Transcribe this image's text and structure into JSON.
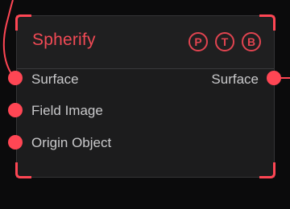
{
  "node": {
    "title": "Spherify",
    "flags": [
      {
        "key": "preview",
        "label": "P"
      },
      {
        "key": "template",
        "label": "T"
      },
      {
        "key": "bypass",
        "label": "B"
      }
    ],
    "inputs": [
      {
        "label": "Surface"
      },
      {
        "label": "Field Image"
      },
      {
        "label": "Origin Object"
      }
    ],
    "outputs": [
      {
        "label": "Surface"
      }
    ]
  },
  "colors": {
    "accent": "#ff4654",
    "title": "#f24a55",
    "node_body": "#1c1c1d",
    "background": "#0b0b0c",
    "label_text": "#c9c9cb"
  }
}
